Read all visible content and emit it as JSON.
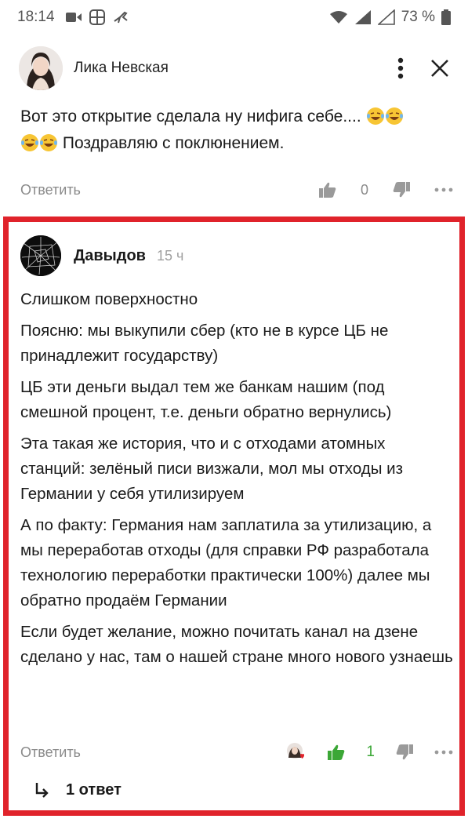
{
  "status_bar": {
    "time": "18:14",
    "battery": "73 %"
  },
  "header": {
    "author": "Лика Невская"
  },
  "previous_comment": {
    "text_line1": "Вот это открытие сделала ну нифига себе....",
    "text_line2": "Поздравляю с поклюнением.",
    "reply_label": "Ответить",
    "likes": "0"
  },
  "comment": {
    "author": "Давыдов",
    "time_ago": "15 ч",
    "paragraphs": [
      "Слишком поверхностно",
      "Поясню: мы выкупили сбер (кто не в курсе ЦБ не принадлежит государству)",
      "ЦБ эти деньги выдал тем же банкам нашим (под смешной процент, т.е. деньги обратно вернулись)",
      "Эта такая же история, что и с отходами атомных станций: зелёный писи визжали, мол мы отходы из Германии у себя утилизируем",
      "А по факту: Германия нам заплатила за утилизацию, а мы переработав отходы (для справки РФ разработала технологию переработки практически 100%) далее мы обратно продаём Германии",
      "Если будет желание, можно почитать канал на дзене сделано у нас, там о нашей стране много нового узнаешь"
    ],
    "reply_label": "Ответить",
    "likes": "1",
    "replies_label": "1 ответ"
  },
  "colors": {
    "highlight": "#e0232b",
    "like_green": "#3ba736",
    "muted": "#8a8a8a"
  }
}
